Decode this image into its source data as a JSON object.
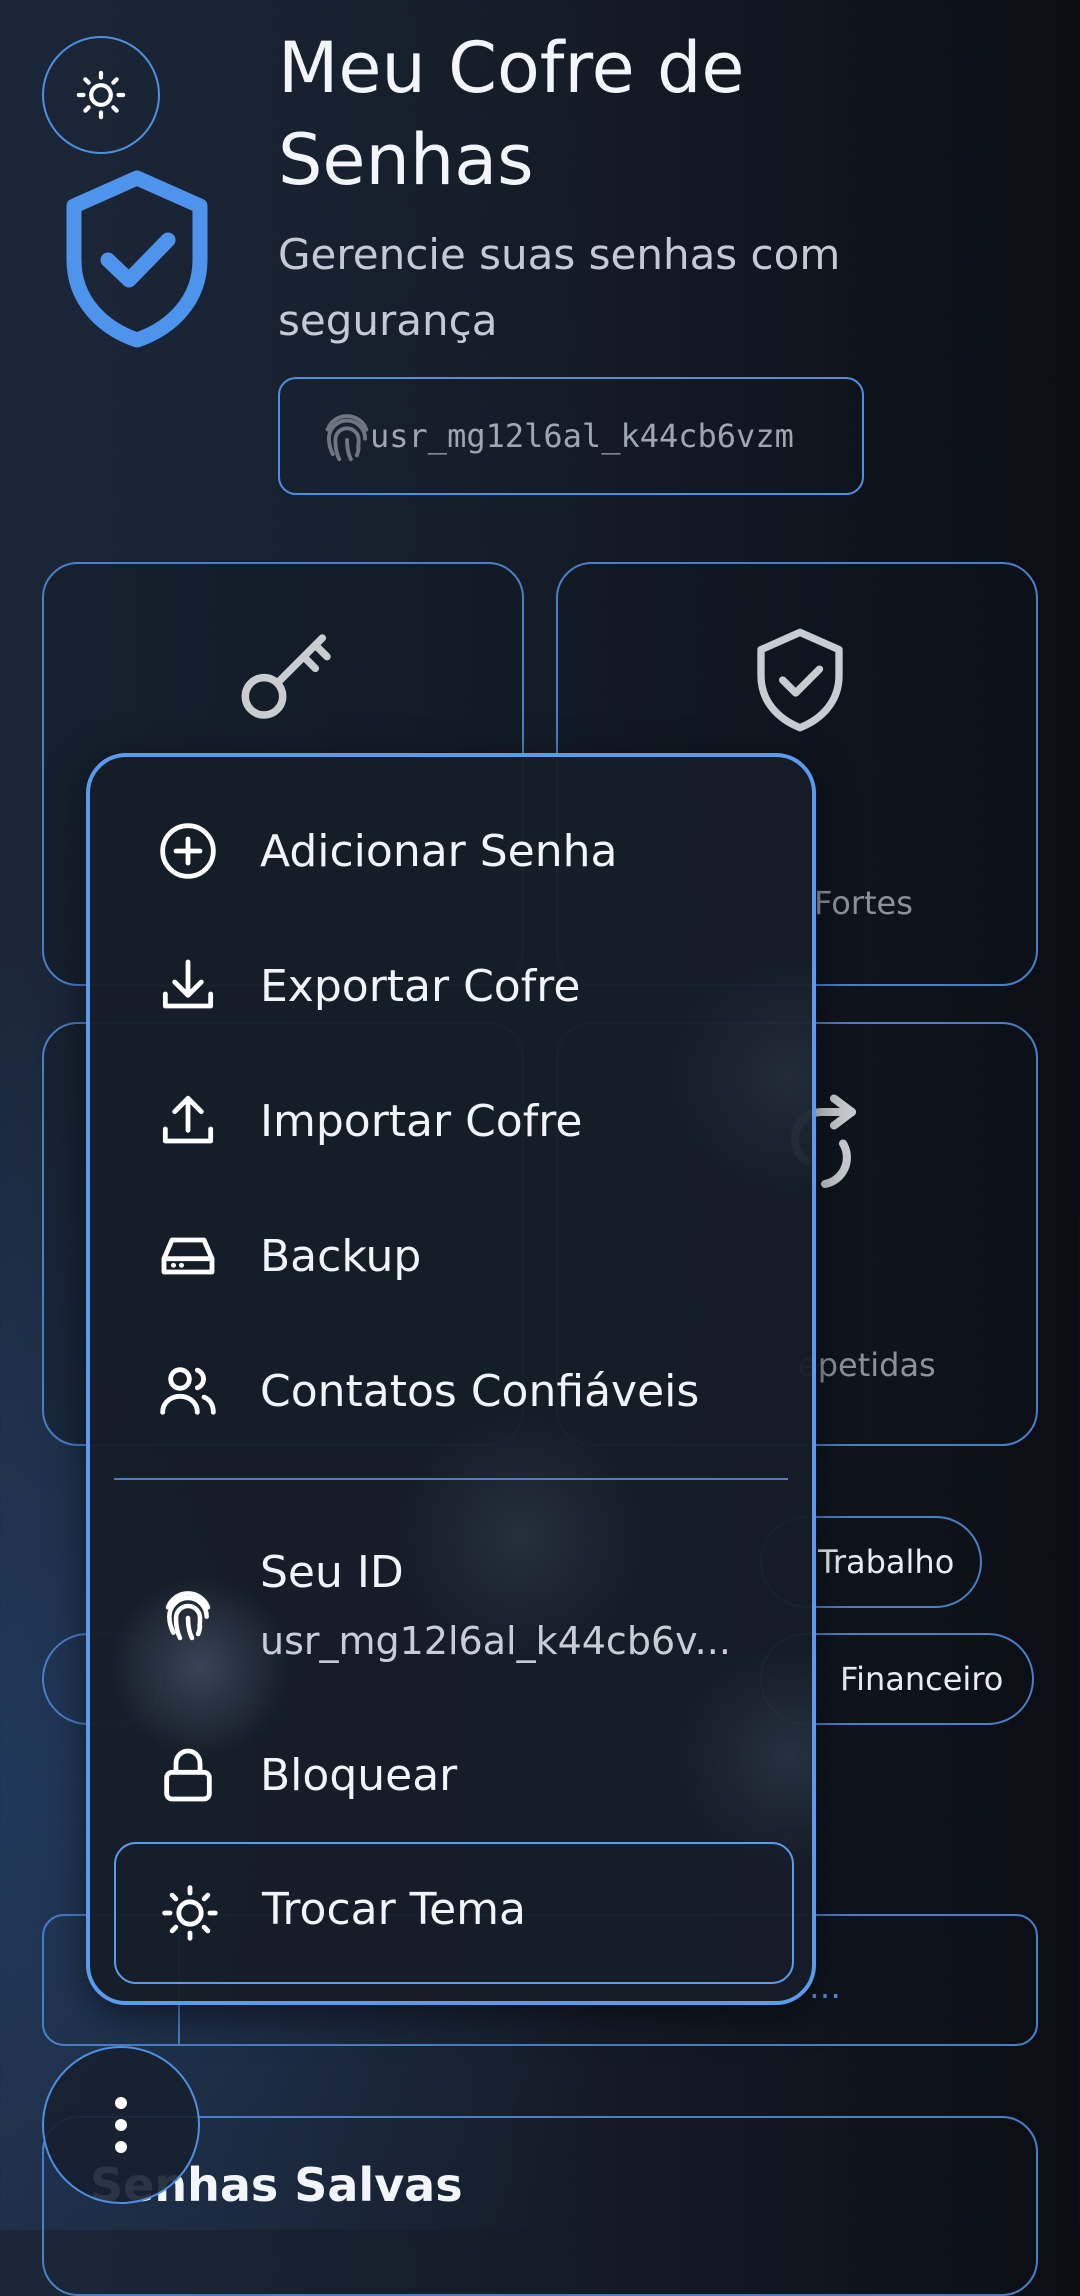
{
  "header": {
    "theme_icon": "sun-icon",
    "logo_icon": "shield-check-icon",
    "title": "Meu Cofre de Senhas",
    "subtitle": "Gerencie suas senhas com segurança",
    "user_id": "usr_mg12l6al_k44cb6vzm",
    "user_id_icon": "fingerprint-icon"
  },
  "stats": {
    "strong_label_partial": "Fortes",
    "repeated_label_partial": "epetidas"
  },
  "categories": {
    "work": "Trabalho",
    "finance": "Financeiro"
  },
  "search_partial": "…",
  "saved_section": {
    "title": "Senhas Salvas"
  },
  "menu": {
    "items": [
      {
        "label": "Adicionar Senha",
        "icon": "plus-circle-icon"
      },
      {
        "label": "Exportar Cofre",
        "icon": "download-icon"
      },
      {
        "label": "Importar Cofre",
        "icon": "upload-icon"
      },
      {
        "label": "Backup",
        "icon": "hard-drive-icon"
      },
      {
        "label": "Contatos Confiáveis",
        "icon": "users-icon"
      }
    ],
    "id_label": "Seu ID",
    "id_value": "usr_mg12l6al_k44cb6v...",
    "lock_label": "Bloquear",
    "theme_label": "Trocar Tema"
  },
  "colors": {
    "accent": "#4f8fe0",
    "menu_border": "#5b9bed",
    "bg": "#141b26"
  }
}
